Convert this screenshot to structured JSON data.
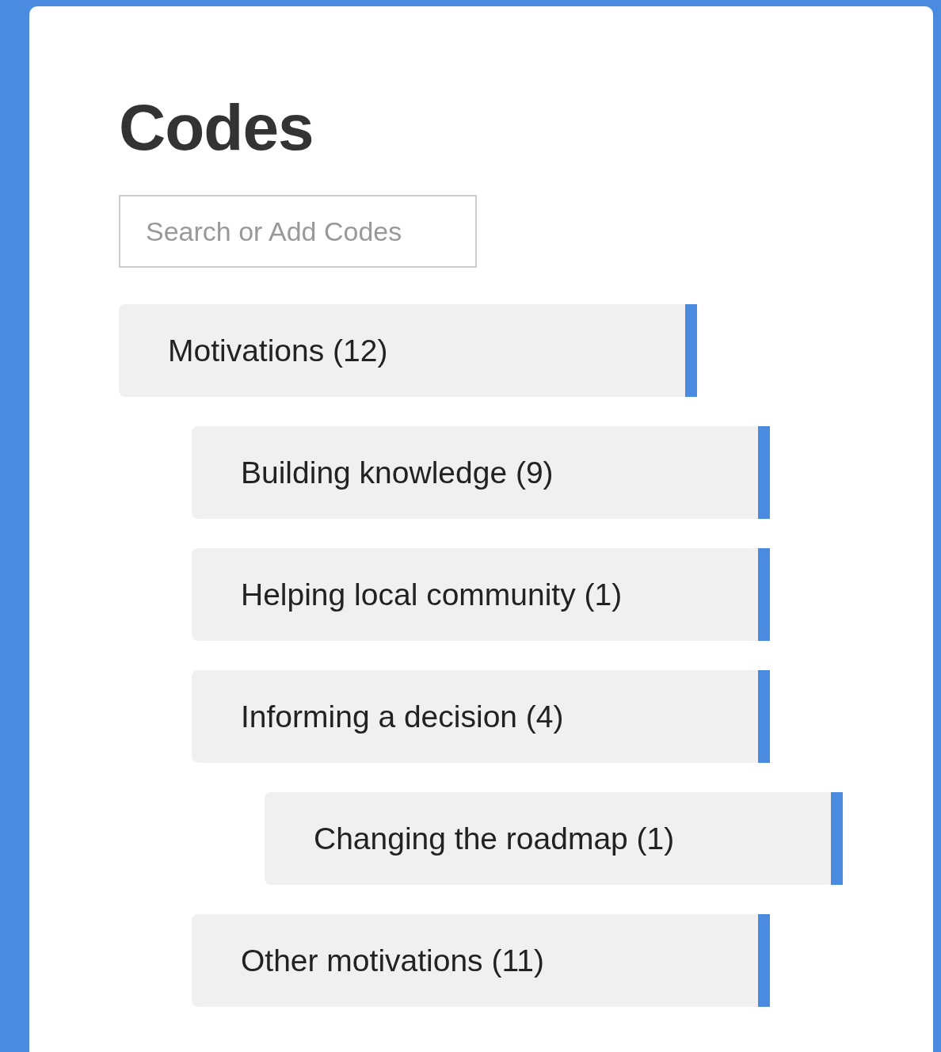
{
  "panel": {
    "title": "Codes"
  },
  "search": {
    "placeholder": "Search or Add Codes"
  },
  "codes": [
    {
      "label": "Motivations (12)",
      "children": [
        {
          "label": "Building knowledge (9)"
        },
        {
          "label": "Helping local community (1)"
        },
        {
          "label": "Informing a decision (4)",
          "children": [
            {
              "label": "Changing the roadmap (1)"
            }
          ]
        },
        {
          "label": "Other motivations (11)"
        }
      ]
    }
  ]
}
